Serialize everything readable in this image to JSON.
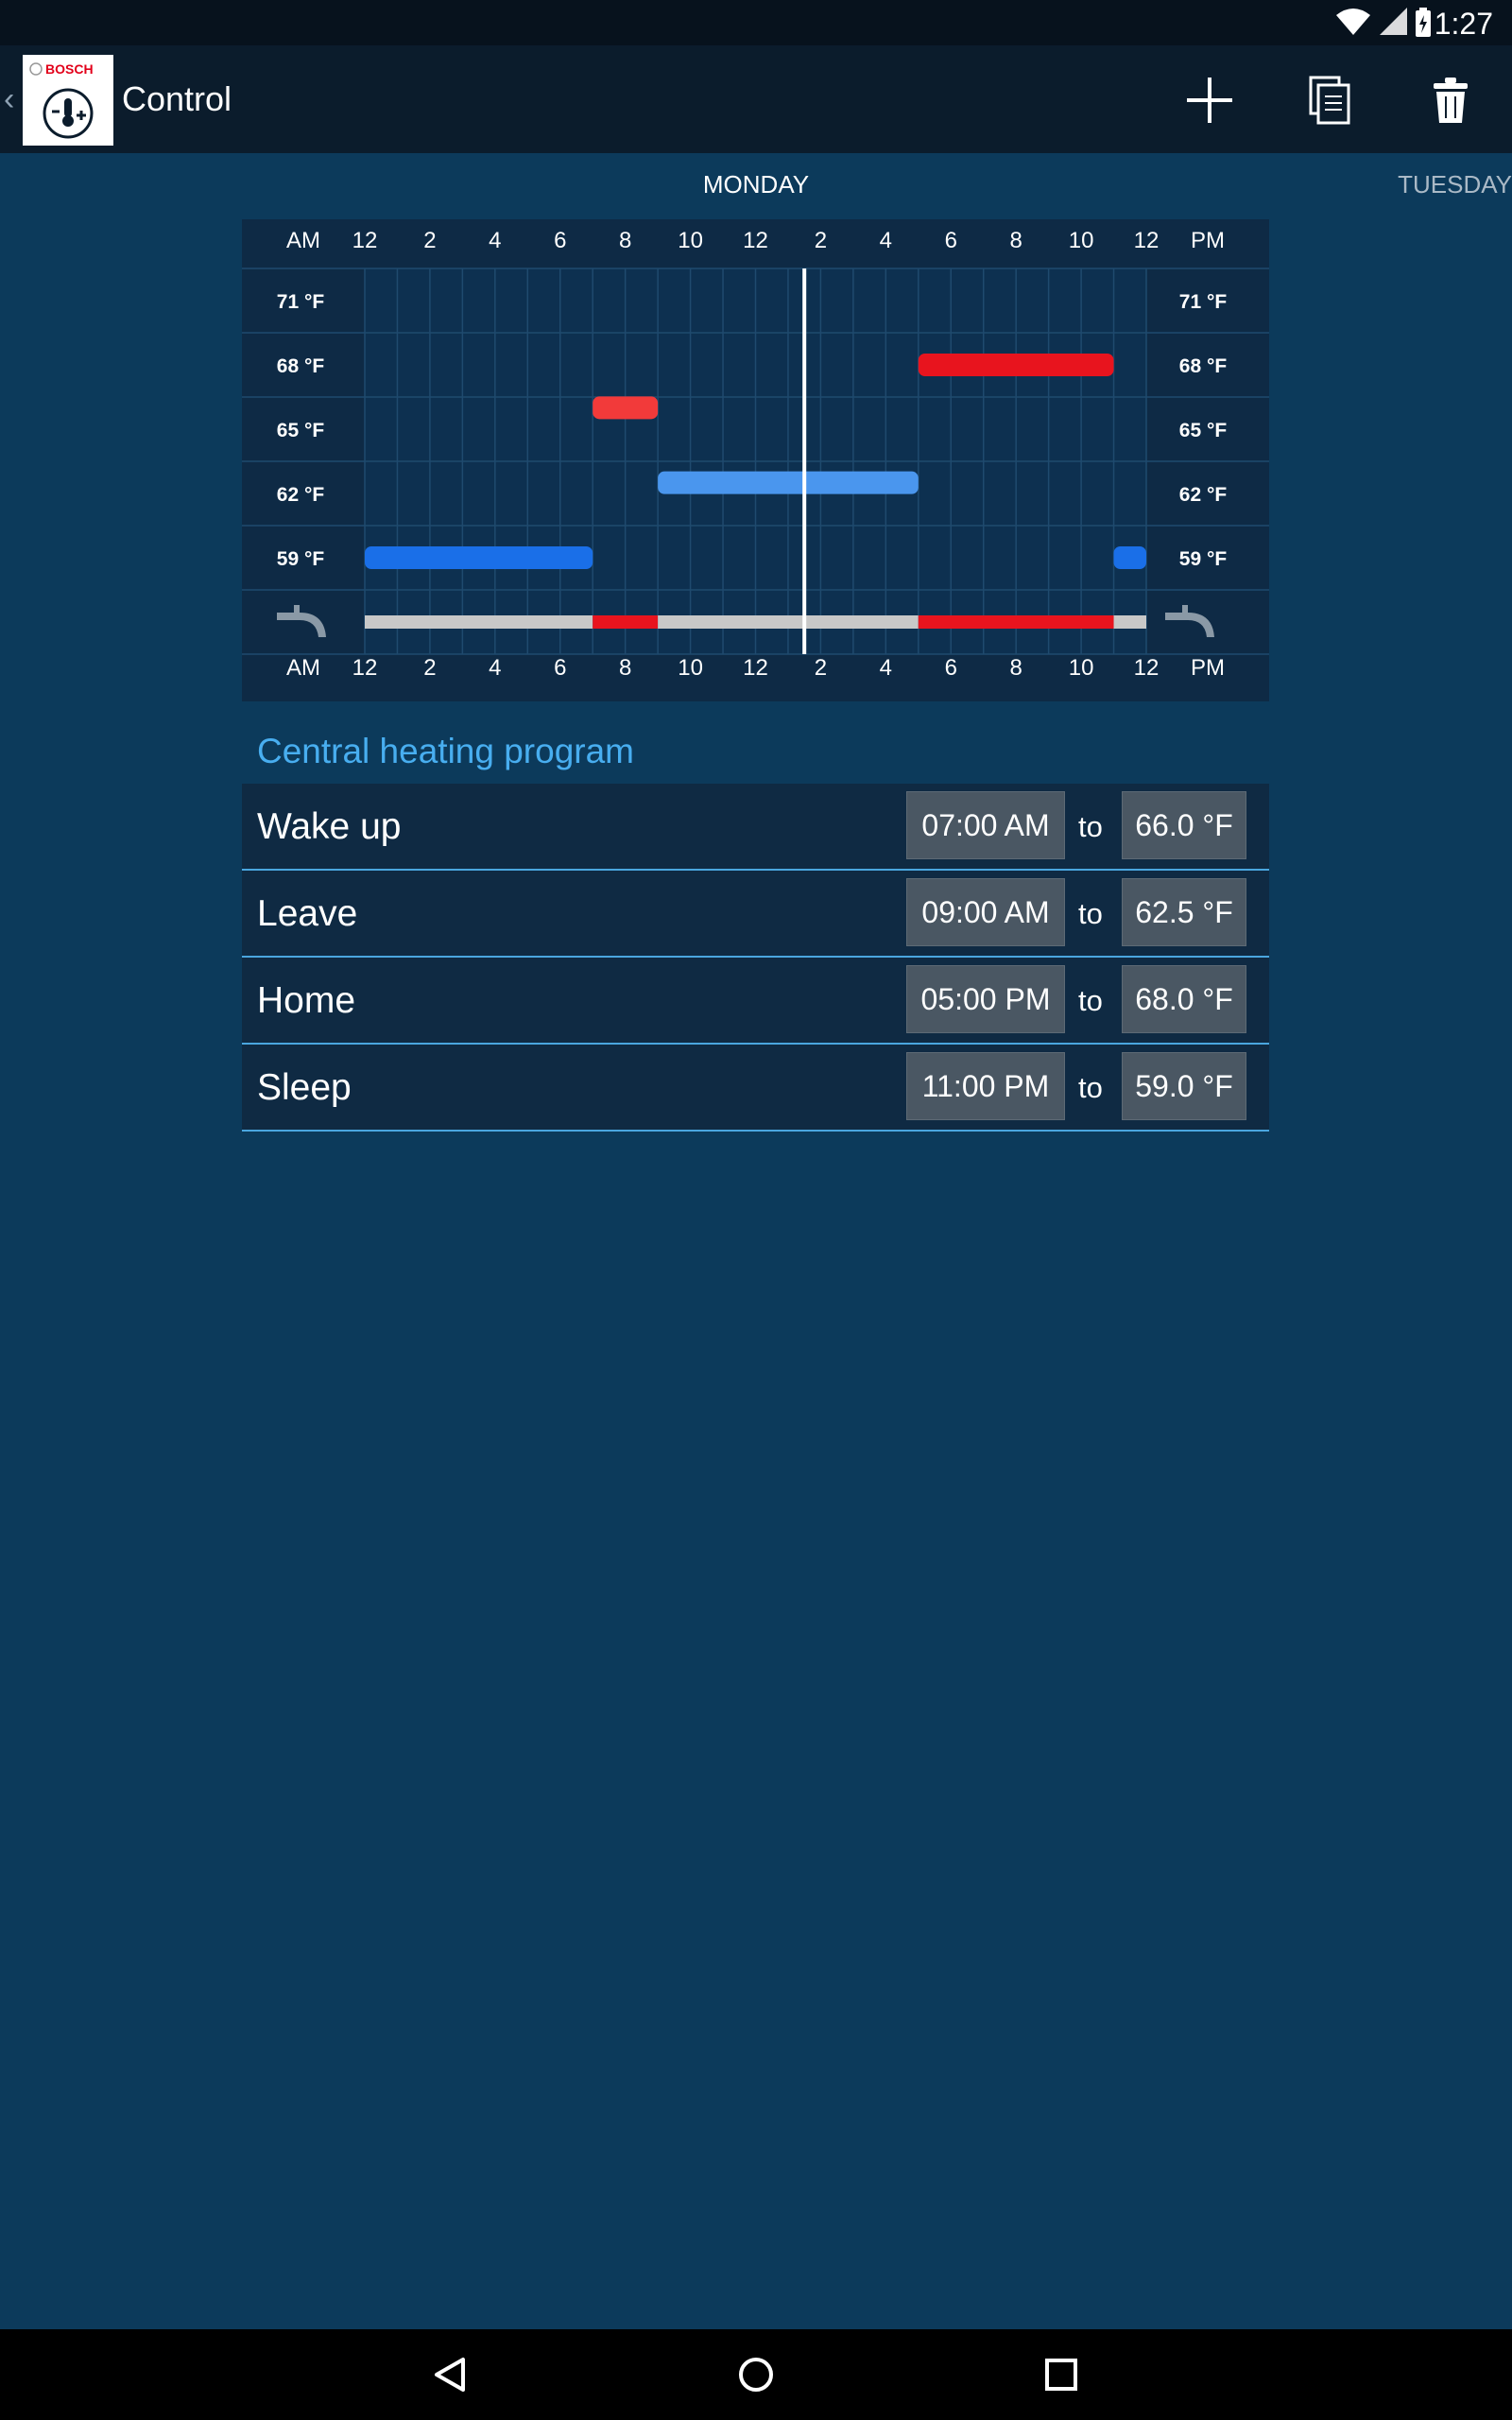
{
  "status_bar": {
    "time": "1:27",
    "icons": [
      "wifi-icon",
      "signal-icon",
      "battery-charging-icon"
    ]
  },
  "app_bar": {
    "back_glyph": "‹",
    "logo_text": "BOSCH",
    "title": "Control",
    "actions": [
      {
        "name": "add-icon"
      },
      {
        "name": "copy-icon"
      },
      {
        "name": "delete-icon"
      }
    ]
  },
  "days": {
    "current": "MONDAY",
    "next": "TUESDAY"
  },
  "chart_data": {
    "type": "timeline",
    "x_label_left": "AM",
    "x_label_right": "PM",
    "x_ticks": [
      "12",
      "2",
      "4",
      "6",
      "8",
      "10",
      "12",
      "2",
      "4",
      "6",
      "8",
      "10",
      "12"
    ],
    "xlim": [
      0,
      24
    ],
    "y_ticks": [
      "71 °F",
      "68 °F",
      "65 °F",
      "62 °F",
      "59 °F"
    ],
    "y_values": [
      71,
      68,
      65,
      62,
      59
    ],
    "current_time_hours": 13.5,
    "segments": [
      {
        "start": 0,
        "end": 7,
        "temp": 59,
        "color": "#1a6fe8"
      },
      {
        "start": 7,
        "end": 9,
        "temp": 66,
        "color": "#f23a3a"
      },
      {
        "start": 9,
        "end": 17,
        "temp": 62.5,
        "color": "#4a96ee"
      },
      {
        "start": 17,
        "end": 23,
        "temp": 68,
        "color": "#e8141e"
      },
      {
        "start": 23,
        "end": 24,
        "temp": 59,
        "color": "#1a6fe8"
      }
    ],
    "hot_water": [
      {
        "start": 0,
        "end": 7,
        "color": "#c8c8c8"
      },
      {
        "start": 7,
        "end": 9,
        "color": "#e8141e"
      },
      {
        "start": 9,
        "end": 17,
        "color": "#c8c8c8"
      },
      {
        "start": 17,
        "end": 23,
        "color": "#e8141e"
      },
      {
        "start": 23,
        "end": 24,
        "color": "#c8c8c8"
      }
    ]
  },
  "program": {
    "title": "Central heating program",
    "to_label": "to",
    "rows": [
      {
        "name": "Wake up",
        "time": "07:00 AM",
        "temp": "66.0 °F"
      },
      {
        "name": "Leave",
        "time": "09:00 AM",
        "temp": "62.5 °F"
      },
      {
        "name": "Home",
        "time": "05:00 PM",
        "temp": "68.0 °F"
      },
      {
        "name": "Sleep",
        "time": "11:00 PM",
        "temp": "59.0 °F"
      }
    ]
  },
  "colors": {
    "background": "#0c3a5b",
    "accent": "#48aef0",
    "heat": "#e8141e",
    "cool": "#1a6fe8"
  }
}
